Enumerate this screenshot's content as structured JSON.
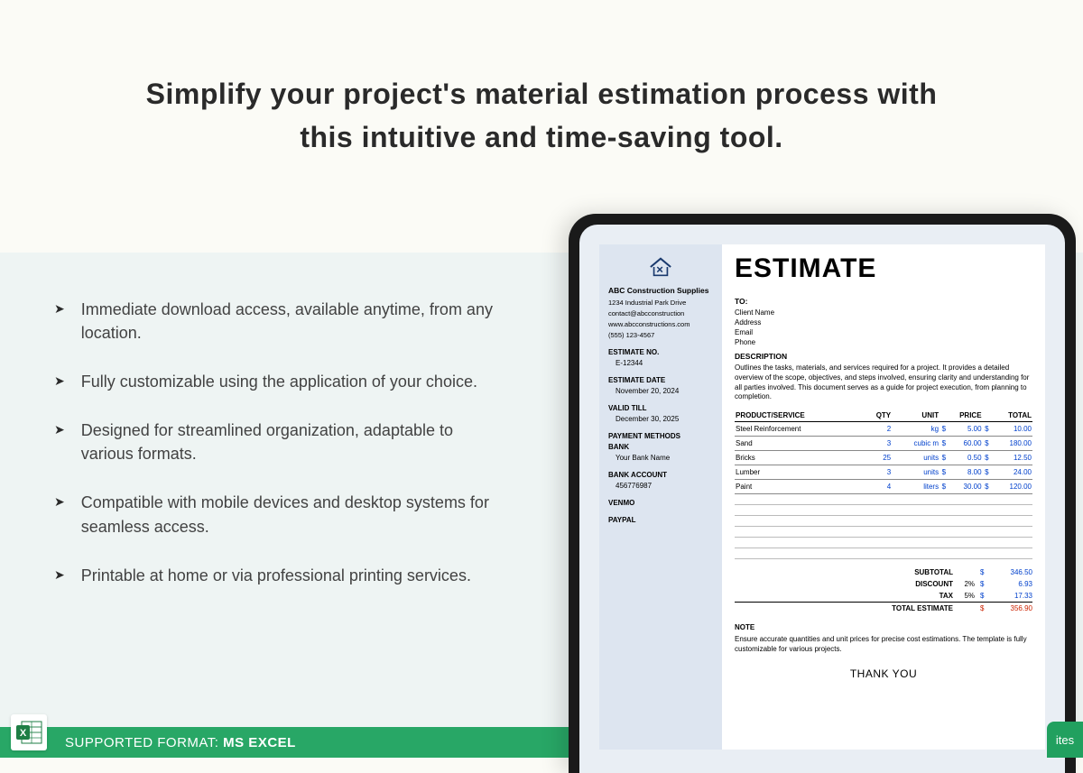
{
  "hero_line1": "Simplify your project's material estimation process with",
  "hero_line2": "this intuitive and time-saving tool.",
  "features": [
    "Immediate download access, available anytime, from any location.",
    "Fully customizable using the application of your choice.",
    "Designed for streamlined organization, adaptable to various formats.",
    "Compatible with mobile devices and desktop systems for seamless access.",
    "Printable at home or via professional printing services."
  ],
  "footer": {
    "prefix": "SUPPORTED FORMAT: ",
    "format": "MS EXCEL",
    "right_tag": "ites"
  },
  "doc": {
    "company": {
      "name": "ABC Construction Supplies",
      "addr": "1234 Industrial Park Drive",
      "email": "contact@abcconstruction",
      "web": "www.abcconstructions.com",
      "phone": "(555) 123-4567"
    },
    "meta": {
      "est_no_label": "ESTIMATE NO.",
      "est_no": "E-12344",
      "est_date_label": "ESTIMATE DATE",
      "est_date": "November 20, 2024",
      "valid_label": "VALID TILL",
      "valid": "December 30, 2025",
      "pay_label": "PAYMENT METHODS",
      "bank_label": "BANK",
      "bank": "Your Bank Name",
      "acct_label": "BANK ACCOUNT",
      "acct": "456776987",
      "venmo_label": "VENMO",
      "paypal_label": "PAYPAL"
    },
    "title": "ESTIMATE",
    "to": {
      "label": "TO:",
      "l1": "Client Name",
      "l2": "Address",
      "l3": "Email",
      "l4": "Phone"
    },
    "desc_label": "DESCRIPTION",
    "desc": "Outlines the tasks, materials, and services required for a project. It provides a detailed overview of the scope, objectives, and steps involved, ensuring clarity and understanding for all parties involved. This document serves as a guide for project execution, from planning to completion.",
    "cols": {
      "prod": "PRODUCT/SERVICE",
      "qty": "QTY",
      "unit": "UNIT",
      "price": "PRICE",
      "total": "TOTAL"
    },
    "rows": [
      {
        "prod": "Steel Reinforcement",
        "qty": "2",
        "unit": "kg",
        "price": "5.00",
        "total": "10.00"
      },
      {
        "prod": "Sand",
        "qty": "3",
        "unit": "cubic m",
        "price": "60.00",
        "total": "180.00"
      },
      {
        "prod": "Bricks",
        "qty": "25",
        "unit": "units",
        "price": "0.50",
        "total": "12.50"
      },
      {
        "prod": "Lumber",
        "qty": "3",
        "unit": "units",
        "price": "8.00",
        "total": "24.00"
      },
      {
        "prod": "Paint",
        "qty": "4",
        "unit": "liters",
        "price": "30.00",
        "total": "120.00"
      }
    ],
    "totals": {
      "subtotal_label": "SUBTOTAL",
      "subtotal": "346.50",
      "discount_label": "DISCOUNT",
      "discount_pct": "2%",
      "discount": "6.93",
      "tax_label": "TAX",
      "tax_pct": "5%",
      "tax": "17.33",
      "grand_label": "TOTAL ESTIMATE",
      "grand": "356.90"
    },
    "note_label": "NOTE",
    "note": "Ensure accurate quantities and unit prices for precise cost estimations. The template is fully customizable for various projects.",
    "thanks": "THANK YOU"
  }
}
